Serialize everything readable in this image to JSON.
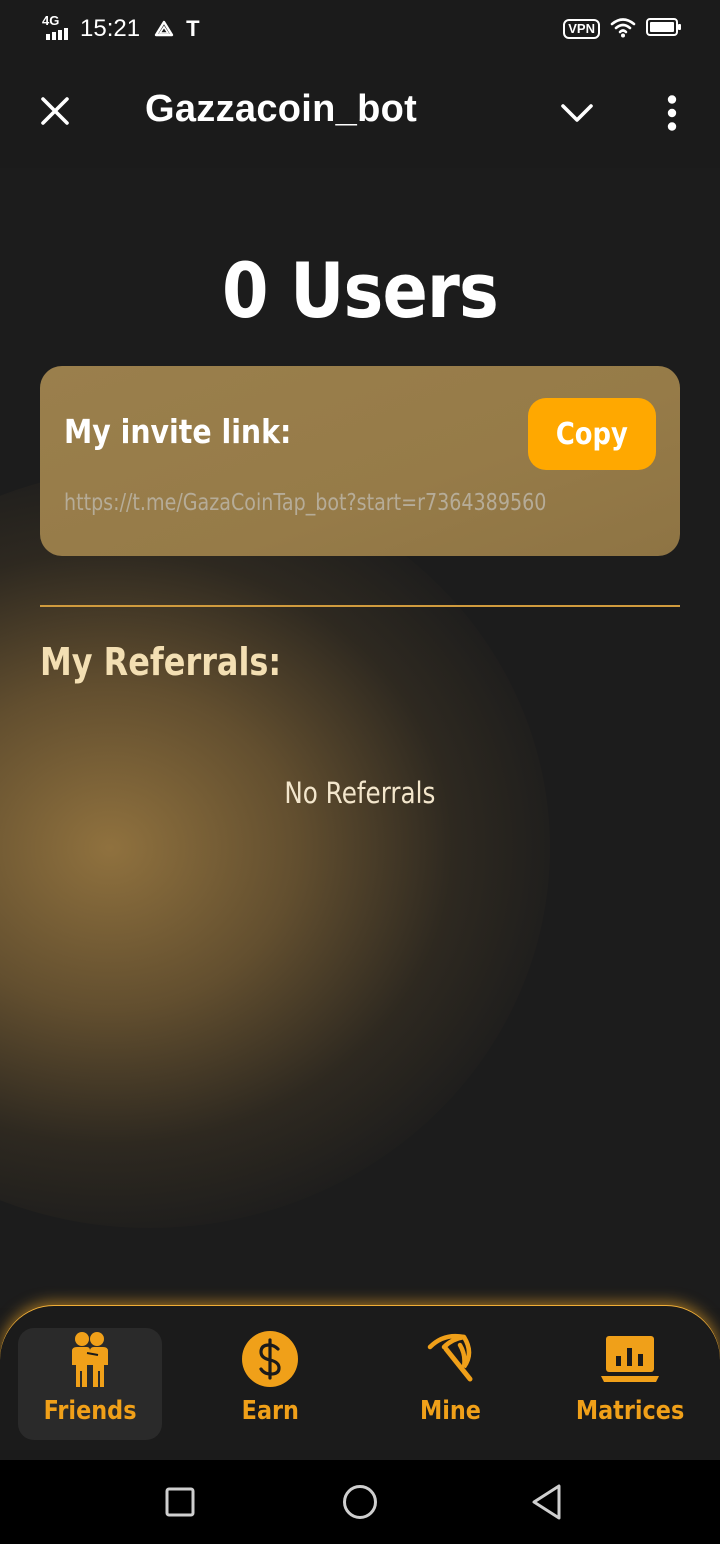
{
  "status_bar": {
    "network": "4G",
    "time": "15:21",
    "carrier_icon": "T",
    "vpn": "VPN",
    "icons": [
      "signal-icon",
      "drive-icon",
      "wifi-icon",
      "battery-icon"
    ]
  },
  "title_bar": {
    "title": "Gazzacoin_bot",
    "icons": [
      "close-icon",
      "chevron-down-icon",
      "more-vertical-icon"
    ]
  },
  "main": {
    "users_count": "0 Users",
    "invite": {
      "label": "My invite link:",
      "copy_label": "Copy",
      "link": "https://t.me/GazaCoinTap_bot?start=r7364389560"
    },
    "referrals": {
      "heading": "My Referrals:",
      "empty_text": "No Referrals"
    }
  },
  "bottom_nav": {
    "items": [
      {
        "label": "Friends",
        "icon": "friends-icon",
        "active": true
      },
      {
        "label": "Earn",
        "icon": "dollar-coin-icon",
        "active": false
      },
      {
        "label": "Mine",
        "icon": "pickaxe-icon",
        "active": false
      },
      {
        "label": "Matrices",
        "icon": "chart-laptop-icon",
        "active": false
      }
    ]
  },
  "colors": {
    "accent": "#ffa800",
    "nav_text": "#f0a019",
    "card": "#9a7f4c",
    "background": "#1c1c1c"
  }
}
